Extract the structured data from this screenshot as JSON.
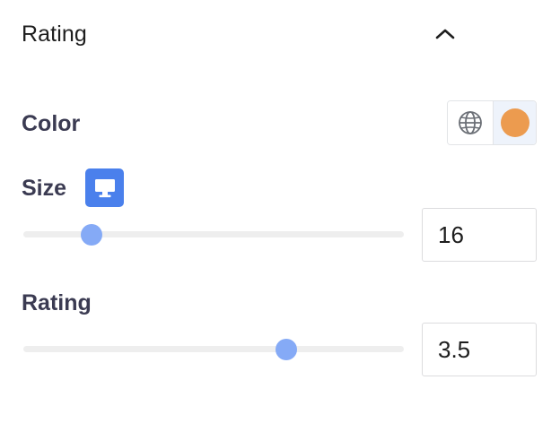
{
  "panel": {
    "title": "Rating"
  },
  "color": {
    "label": "Color",
    "global_icon": "globe-icon",
    "swatch": "#ec9b4f"
  },
  "size": {
    "label": "Size",
    "device_icon": "desktop-icon",
    "device_color": "#4a80ec",
    "value": "16",
    "slider_fraction": 0.18
  },
  "rating": {
    "label": "Rating",
    "value": "3.5",
    "slider_fraction": 0.69
  },
  "colors": {
    "slider_thumb": "#85aaf6",
    "slider_track": "#eeeeee"
  }
}
